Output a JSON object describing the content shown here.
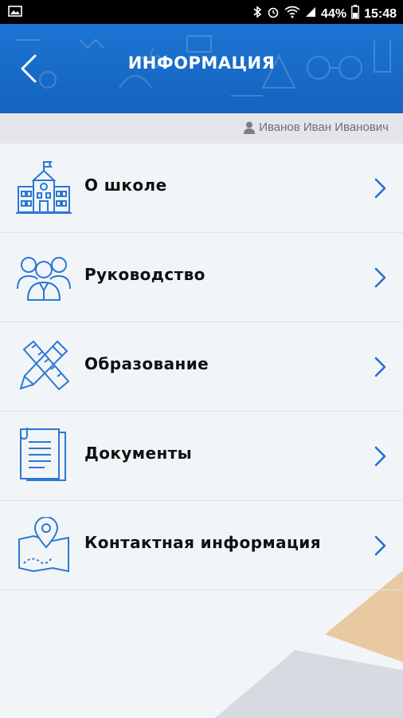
{
  "status": {
    "battery": "44%",
    "time": "15:48"
  },
  "header": {
    "title": "ИНФОРМАЦИЯ"
  },
  "user": {
    "name": "Иванов Иван Иванович"
  },
  "menu": {
    "items": [
      {
        "label": "О школе",
        "icon": "school-building-icon"
      },
      {
        "label": "Руководство",
        "icon": "people-group-icon"
      },
      {
        "label": "Образование",
        "icon": "pencil-ruler-icon"
      },
      {
        "label": "Документы",
        "icon": "documents-icon"
      },
      {
        "label": "Контактная информация",
        "icon": "map-pin-icon"
      }
    ]
  },
  "colors": {
    "header": "#1a6dcc",
    "accent": "#1e6fd0",
    "icon": "#2a78d4",
    "background": "#f2f5f8",
    "decor_tan": "#e9c9a1",
    "decor_grey": "#d7dbe1"
  }
}
